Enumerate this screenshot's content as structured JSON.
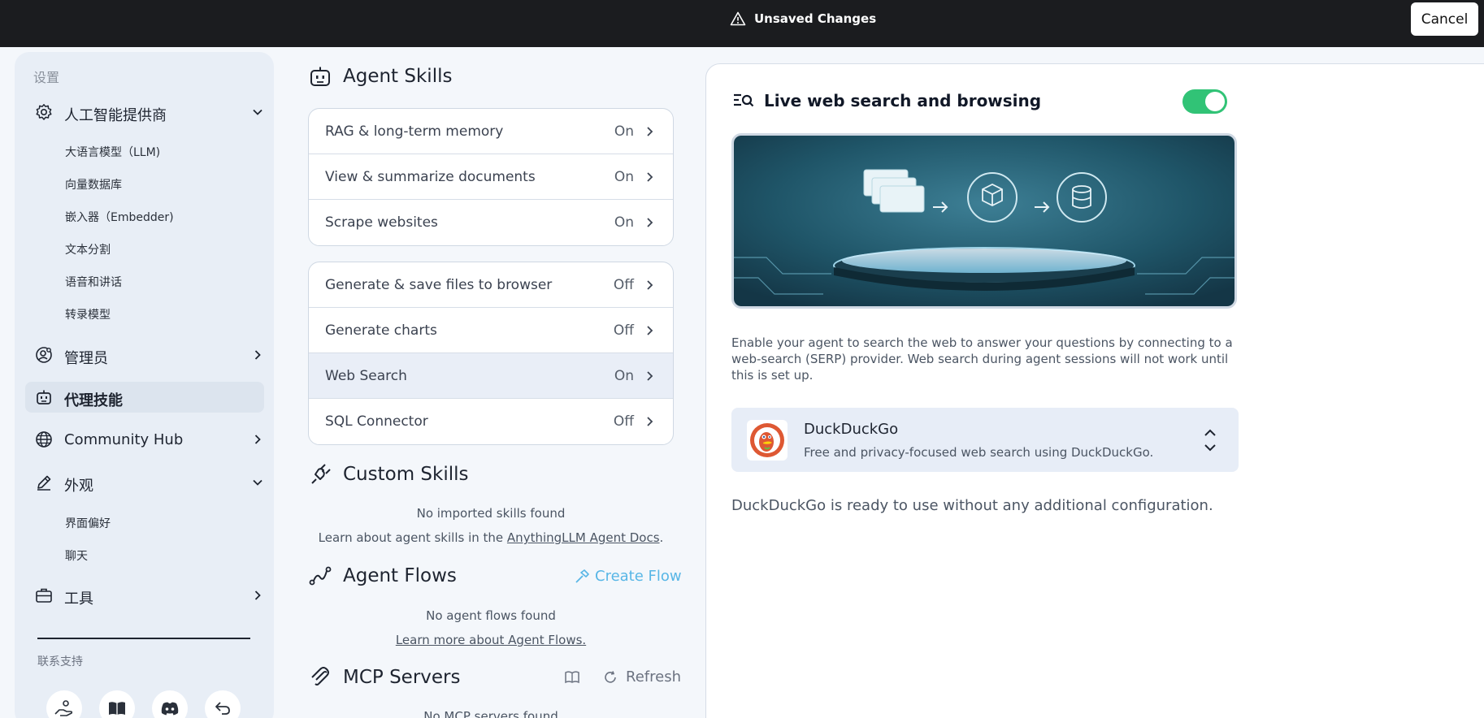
{
  "topbar": {
    "warning_icon": "warning-triangle-icon",
    "unsaved_label": "Unsaved Changes",
    "cancel_label": "Cancel"
  },
  "sidebar": {
    "heading": "设置",
    "categories": {
      "ai_providers": {
        "label": "人工智能提供商",
        "icon": "gear-icon",
        "sub_items": [
          "大语言模型（LLM)",
          "向量数据库",
          "嵌入器（Embedder)",
          "文本分割",
          "语音和讲话",
          "转录模型"
        ]
      },
      "admin": {
        "label": "管理员",
        "icon": "user-gear-icon"
      },
      "agent_skills": {
        "label": "代理技能",
        "icon": "robot-icon"
      },
      "community_hub": {
        "label": "Community Hub",
        "icon": "globe-icon"
      },
      "appearance": {
        "label": "外观",
        "icon": "pencil-icon",
        "sub_items": [
          "界面偏好",
          "聊天"
        ]
      },
      "tools": {
        "label": "工具",
        "icon": "toolbox-icon"
      }
    },
    "support_label": "联系支持",
    "bottom_icons": [
      "support-hand-icon",
      "book-icon",
      "discord-icon",
      "back-arrow-icon"
    ]
  },
  "agent_skills": {
    "title": "Agent Skills",
    "default_skills": [
      {
        "name": "RAG & long-term memory",
        "status": "On"
      },
      {
        "name": "View & summarize documents",
        "status": "On"
      },
      {
        "name": "Scrape websites",
        "status": "On"
      }
    ],
    "configurable_skills": [
      {
        "name": "Generate & save files to browser",
        "status": "Off"
      },
      {
        "name": "Generate charts",
        "status": "Off"
      },
      {
        "name": "Web Search",
        "status": "On"
      },
      {
        "name": "SQL Connector",
        "status": "Off"
      }
    ]
  },
  "custom_skills": {
    "title": "Custom Skills",
    "empty": "No imported skills found",
    "learn_prefix": "Learn about agent skills in the ",
    "learn_link": "AnythingLLM Agent Docs",
    "learn_suffix": "."
  },
  "agent_flows": {
    "title": "Agent Flows",
    "create_label": "Create Flow",
    "empty": "No agent flows found",
    "learn_link": "Learn more about Agent Flows."
  },
  "mcp_servers": {
    "title": "MCP Servers",
    "refresh_label": "Refresh",
    "empty": "No MCP servers found"
  },
  "web_search": {
    "title": "Live web search and browsing",
    "enabled": true,
    "description": "Enable your agent to search the web to answer your questions by connecting to a web-search (SERP) provider. Web search during agent sessions will not work until this is set up.",
    "provider": {
      "name": "DuckDuckGo",
      "description": "Free and privacy-focused web search using DuckDuckGo."
    },
    "ready_text": "DuckDuckGo is ready to use without any additional configuration."
  },
  "colors": {
    "accent_toggle": "#31c376",
    "link_blue": "#58b6e6",
    "topbar_bg": "#1b1c1f"
  }
}
